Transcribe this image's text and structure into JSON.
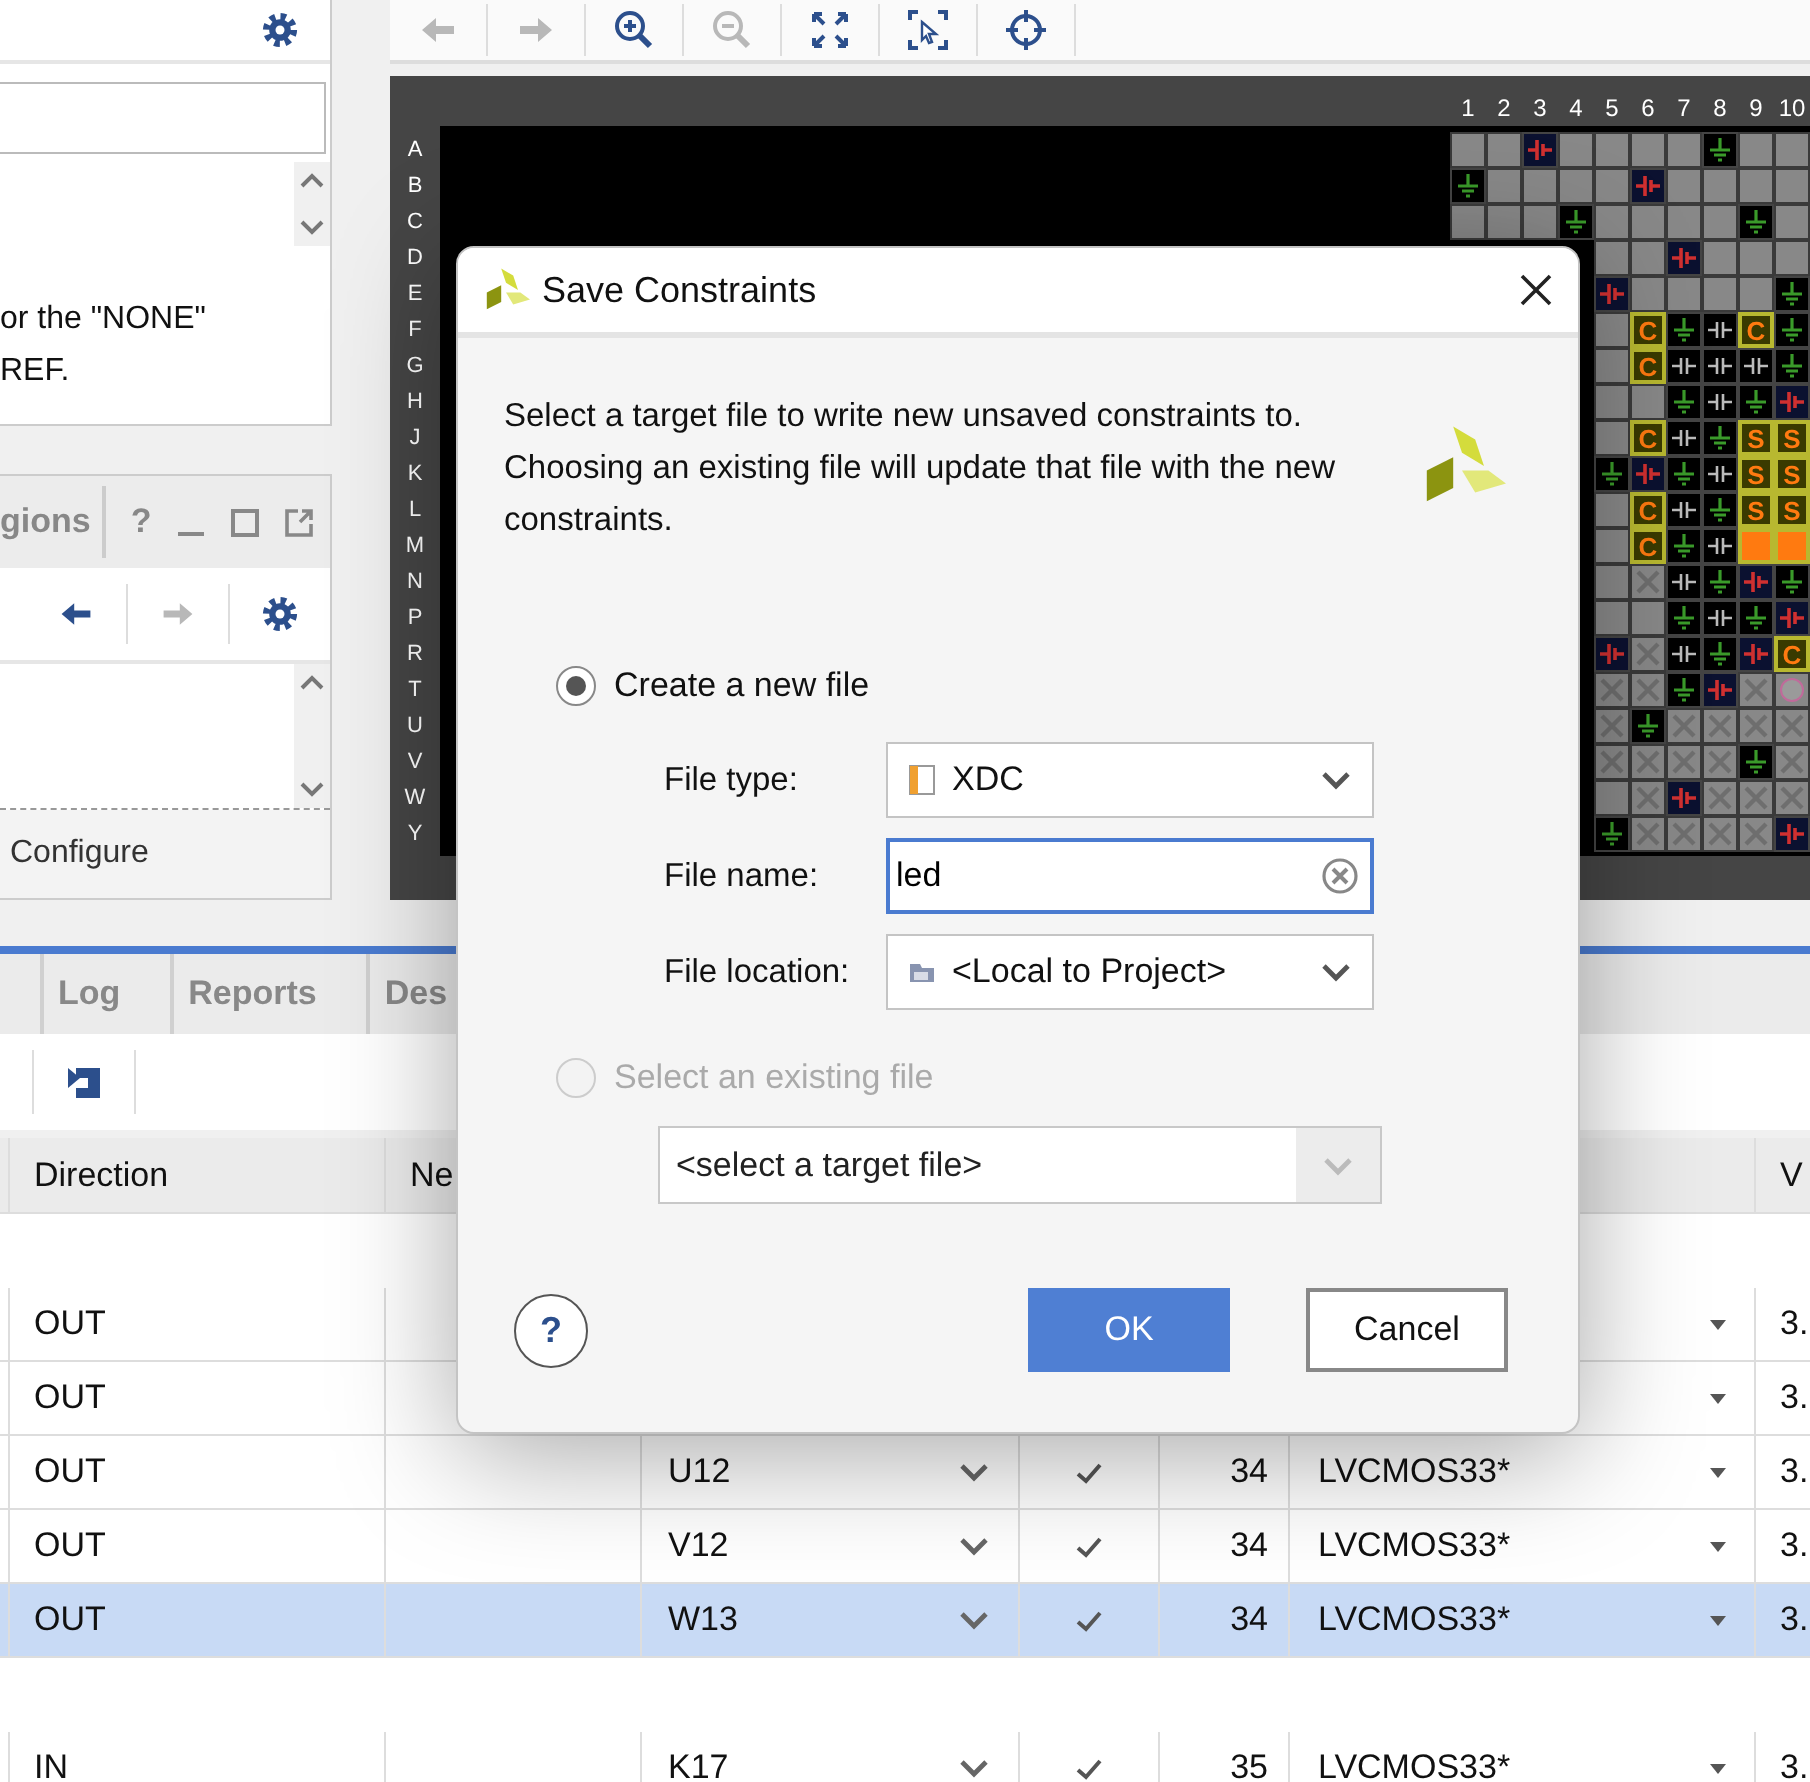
{
  "properties_panel": {
    "lines": [
      "or the \"NONE\"",
      "REF."
    ]
  },
  "sources_panel": {
    "tab": "gions",
    "help": "?",
    "footer": "Configure"
  },
  "device_view": {
    "column_labels": [
      "1",
      "2",
      "3",
      "4",
      "5",
      "6",
      "7",
      "8",
      "9",
      "10"
    ],
    "rows": [
      {
        "label": "A",
        "cells": [
          {
            "kind": "unused"
          },
          {
            "kind": "unused"
          },
          {
            "kind": "supply"
          },
          {
            "kind": "unused"
          },
          {
            "kind": "unused"
          },
          {
            "kind": "unused"
          },
          {
            "kind": "unused"
          },
          {
            "kind": "ground"
          },
          {
            "kind": "unused"
          },
          {
            "kind": "unused"
          }
        ]
      },
      {
        "label": "B",
        "cells": [
          {
            "kind": "ground"
          },
          {
            "kind": "unused"
          },
          {
            "kind": "unused"
          },
          {
            "kind": "unused"
          },
          {
            "kind": "unused"
          },
          {
            "kind": "supply"
          },
          {
            "kind": "unused"
          },
          {
            "kind": "unused"
          },
          {
            "kind": "unused"
          },
          {
            "kind": "unused"
          }
        ]
      },
      {
        "label": "C",
        "cells": [
          {
            "kind": "unused"
          },
          {
            "kind": "unused"
          },
          {
            "kind": "unused"
          },
          {
            "kind": "ground"
          },
          {
            "kind": "unused"
          },
          {
            "kind": "unused"
          },
          {
            "kind": "unused"
          },
          {
            "kind": "unused"
          },
          {
            "kind": "ground"
          },
          {
            "kind": "unused"
          }
        ]
      },
      {
        "label": "D",
        "cells": [
          {
            "kind": "unused"
          },
          {
            "kind": "unused"
          },
          {
            "kind": "supply"
          },
          {
            "kind": "unused"
          },
          {
            "kind": "unused"
          },
          {
            "kind": "unused"
          }
        ]
      },
      {
        "label": "E",
        "cells": [
          {
            "kind": "supply"
          },
          {
            "kind": "unused"
          },
          {
            "kind": "unused"
          },
          {
            "kind": "unused"
          },
          {
            "kind": "unused"
          },
          {
            "kind": "ground"
          }
        ]
      },
      {
        "label": "F",
        "cells": [
          {
            "kind": "unused"
          },
          {
            "kind": "io",
            "label": "C"
          },
          {
            "kind": "ground"
          },
          {
            "kind": "signal"
          },
          {
            "kind": "io",
            "label": "C"
          },
          {
            "kind": "ground"
          }
        ]
      },
      {
        "label": "G",
        "cells": [
          {
            "kind": "unused"
          },
          {
            "kind": "io",
            "label": "C"
          },
          {
            "kind": "signal"
          },
          {
            "kind": "signal"
          },
          {
            "kind": "signal"
          },
          {
            "kind": "ground"
          }
        ]
      },
      {
        "label": "H",
        "cells": [
          {
            "kind": "unused"
          },
          {
            "kind": "unused"
          },
          {
            "kind": "ground"
          },
          {
            "kind": "signal"
          },
          {
            "kind": "ground"
          },
          {
            "kind": "supply"
          }
        ]
      },
      {
        "label": "J",
        "cells": [
          {
            "kind": "unused"
          },
          {
            "kind": "io",
            "label": "C"
          },
          {
            "kind": "signal"
          },
          {
            "kind": "ground"
          },
          {
            "kind": "io",
            "label": "S"
          },
          {
            "kind": "io",
            "label": "S"
          }
        ]
      },
      {
        "label": "K",
        "cells": [
          {
            "kind": "ground"
          },
          {
            "kind": "supply"
          },
          {
            "kind": "ground"
          },
          {
            "kind": "signal"
          },
          {
            "kind": "io",
            "label": "S"
          },
          {
            "kind": "io",
            "label": "S"
          }
        ]
      },
      {
        "label": "L",
        "cells": [
          {
            "kind": "unused"
          },
          {
            "kind": "io",
            "label": "C"
          },
          {
            "kind": "signal"
          },
          {
            "kind": "ground"
          },
          {
            "kind": "io",
            "label": "S"
          },
          {
            "kind": "io",
            "label": "S"
          }
        ]
      },
      {
        "label": "M",
        "cells": [
          {
            "kind": "unused"
          },
          {
            "kind": "io",
            "label": "C"
          },
          {
            "kind": "ground"
          },
          {
            "kind": "signal"
          },
          {
            "kind": "filled"
          },
          {
            "kind": "filled"
          }
        ]
      },
      {
        "label": "N",
        "cells": [
          {
            "kind": "unused"
          },
          {
            "kind": "blocked"
          },
          {
            "kind": "signal"
          },
          {
            "kind": "ground"
          },
          {
            "kind": "supply"
          },
          {
            "kind": "ground"
          }
        ]
      },
      {
        "label": "P",
        "cells": [
          {
            "kind": "unused"
          },
          {
            "kind": "unused"
          },
          {
            "kind": "ground"
          },
          {
            "kind": "signal"
          },
          {
            "kind": "ground"
          },
          {
            "kind": "supply"
          }
        ]
      },
      {
        "label": "R",
        "cells": [
          {
            "kind": "supply"
          },
          {
            "kind": "blocked"
          },
          {
            "kind": "signal"
          },
          {
            "kind": "ground"
          },
          {
            "kind": "supply"
          },
          {
            "kind": "io",
            "label": "C"
          }
        ]
      },
      {
        "label": "T",
        "cells": [
          {
            "kind": "blocked"
          },
          {
            "kind": "blocked"
          },
          {
            "kind": "ground"
          },
          {
            "kind": "supply"
          },
          {
            "kind": "blocked"
          },
          {
            "kind": "round"
          }
        ]
      },
      {
        "label": "U",
        "cells": [
          {
            "kind": "blocked"
          },
          {
            "kind": "ground"
          },
          {
            "kind": "blocked"
          },
          {
            "kind": "blocked"
          },
          {
            "kind": "blocked"
          },
          {
            "kind": "blocked"
          }
        ]
      },
      {
        "label": "V",
        "cells": [
          {
            "kind": "blocked"
          },
          {
            "kind": "blocked"
          },
          {
            "kind": "blocked"
          },
          {
            "kind": "blocked"
          },
          {
            "kind": "ground"
          },
          {
            "kind": "blocked"
          }
        ]
      },
      {
        "label": "W",
        "cells": [
          {
            "kind": "unused"
          },
          {
            "kind": "blocked"
          },
          {
            "kind": "supply"
          },
          {
            "kind": "blocked"
          },
          {
            "kind": "blocked"
          },
          {
            "kind": "blocked"
          }
        ]
      },
      {
        "label": "Y",
        "cells": [
          {
            "kind": "ground"
          },
          {
            "kind": "blocked"
          },
          {
            "kind": "blocked"
          },
          {
            "kind": "blocked"
          },
          {
            "kind": "blocked"
          },
          {
            "kind": "supply"
          }
        ]
      }
    ]
  },
  "bottom_panel": {
    "tabs": [
      {
        "label": "Log",
        "selected": false
      },
      {
        "label": "Reports",
        "selected": false
      },
      {
        "label": "Des",
        "selected": false
      }
    ],
    "table": {
      "columns": [
        "Direction",
        "Ne",
        "V"
      ],
      "rows": [
        {
          "kind": "group",
          "selected": false
        },
        {
          "kind": "port",
          "direction": "OUT",
          "vcco": "3.",
          "selected": false
        },
        {
          "kind": "port",
          "direction": "OUT",
          "vcco": "3.",
          "selected": false
        },
        {
          "kind": "port",
          "direction": "OUT",
          "package_pin": "U12",
          "fixed": true,
          "bank": "34",
          "io_std": "LVCMOS33*",
          "vcco": "3.",
          "selected": false
        },
        {
          "kind": "port",
          "direction": "OUT",
          "package_pin": "V12",
          "fixed": true,
          "bank": "34",
          "io_std": "LVCMOS33*",
          "vcco": "3.",
          "selected": false
        },
        {
          "kind": "port",
          "direction": "OUT",
          "package_pin": "W13",
          "fixed": true,
          "bank": "34",
          "io_std": "LVCMOS33*",
          "vcco": "3.",
          "selected": true
        },
        {
          "kind": "group",
          "selected": false
        },
        {
          "kind": "port",
          "direction": "IN",
          "package_pin": "K17",
          "fixed": true,
          "bank": "35",
          "io_std": "LVCMOS33*",
          "vcco": "3.",
          "selected": false
        }
      ]
    }
  },
  "dialog": {
    "title": "Save Constraints",
    "message": "Select a target file to write new unsaved constraints to. Choosing an existing file will update that file with the new constraints.",
    "new_file": {
      "label": "Create a new file",
      "selected": true,
      "disabled": false
    },
    "fields": [
      {
        "kind": "filetype",
        "label": "File type:",
        "value": "XDC"
      },
      {
        "kind": "input",
        "label": "File name:",
        "value": "led",
        "focused": true
      },
      {
        "kind": "location",
        "label": "File location:",
        "value": "<Local to Project>"
      }
    ],
    "existing_file": {
      "label": "Select an existing file",
      "selected": false,
      "disabled": true
    },
    "existing_select": {
      "value": "<select a target file>",
      "disabled": true
    },
    "help": "?",
    "buttons": [
      {
        "label": "OK",
        "kind": "primary"
      },
      {
        "label": "Cancel",
        "kind": "secondary"
      }
    ]
  }
}
